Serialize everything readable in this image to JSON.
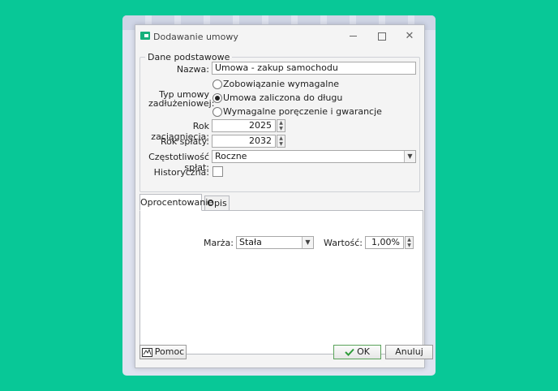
{
  "window": {
    "title": "Dodawanie umowy"
  },
  "group": {
    "legend": "Dane podstawowe",
    "name_label": "Nazwa:",
    "name_value": "Umowa - zakup samochodu",
    "type_label": "Typ umowy zadłużeniowej:",
    "type_options": [
      "Zobowiązanie wymagalne",
      "Umowa zaliczona do długu",
      "Wymagalne poręczenie i gwarancje"
    ],
    "type_selected": "Umowa zaliczona do długu",
    "year_start_label": "Rok zaciągnięcia:",
    "year_start_value": "2025",
    "year_end_label": "Rok spłaty:",
    "year_end_value": "2032",
    "frequency_label": "Częstotliwość spłat:",
    "frequency_value": "Roczne",
    "historical_label": "Historyczna:",
    "historical_checked": false
  },
  "tabs": [
    {
      "label": "Oprocentowanie"
    },
    {
      "label": "Opis"
    }
  ],
  "interest": {
    "margin_label": "Marża:",
    "margin_value": "Stała",
    "value_label": "Wartość:",
    "value_value": "1,00%"
  },
  "footer": {
    "help_label": "Pomoc",
    "ok_label": "OK",
    "cancel_label": "Anuluj"
  },
  "colors": {
    "background": "#08c897",
    "accent": "#17b07c"
  }
}
